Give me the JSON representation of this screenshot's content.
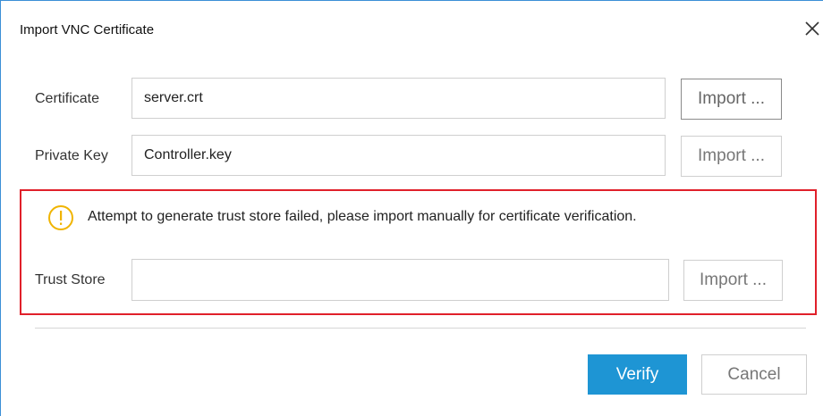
{
  "dialog": {
    "title": "Import VNC Certificate",
    "close_icon": "close-icon"
  },
  "certificate": {
    "label": "Certificate",
    "value": "server.crt",
    "import_label": "Import ..."
  },
  "private_key": {
    "label": "Private Key",
    "value": "Controller.key",
    "import_label": "Import ..."
  },
  "warning": {
    "icon": "warning-icon",
    "message": "Attempt to generate trust store failed, please import manually for certificate verification.",
    "highlight_color": "#e0202a",
    "icon_color": "#f0b400"
  },
  "trust_store": {
    "label": "Trust Store",
    "value": "",
    "import_label": "Import ..."
  },
  "footer": {
    "verify_label": "Verify",
    "cancel_label": "Cancel",
    "primary_color": "#1e95d4"
  }
}
